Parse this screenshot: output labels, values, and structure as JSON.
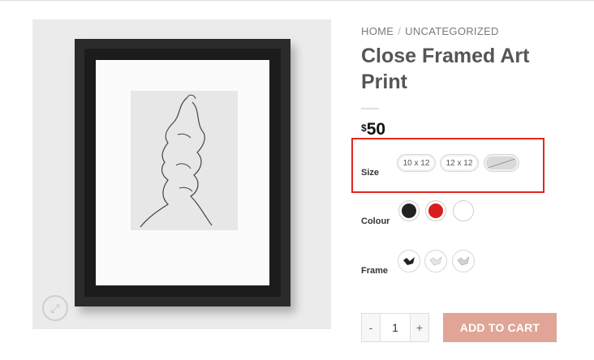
{
  "breadcrumb": {
    "home": "HOME",
    "separator": "/",
    "category": "UNCATEGORIZED"
  },
  "product": {
    "title": "Close Framed Art Print",
    "price_currency": "$",
    "price_amount": "50"
  },
  "size": {
    "label": "Size",
    "options": [
      {
        "label": "10 x 12",
        "available": true
      },
      {
        "label": "12 x 12",
        "available": true
      },
      {
        "label": "",
        "available": false
      }
    ]
  },
  "colour": {
    "label": "Colour",
    "options": [
      {
        "name": "black",
        "color": "#222222"
      },
      {
        "name": "red",
        "color": "#d81e1e"
      },
      {
        "name": "white",
        "color": "#ffffff"
      }
    ]
  },
  "frame": {
    "label": "Frame",
    "options": [
      {
        "name": "black-frame-icon",
        "color": "#222222"
      },
      {
        "name": "white-frame-icon",
        "color": "#dddddd"
      },
      {
        "name": "light-frame-icon",
        "color": "#cccccc"
      }
    ]
  },
  "cart": {
    "minus": "-",
    "plus": "+",
    "quantity": "1",
    "add_label": "ADD TO CART"
  },
  "colors": {
    "accent": "#e0a596",
    "highlight": "#e3261e"
  },
  "icons": {
    "zoom": "expand-icon"
  }
}
